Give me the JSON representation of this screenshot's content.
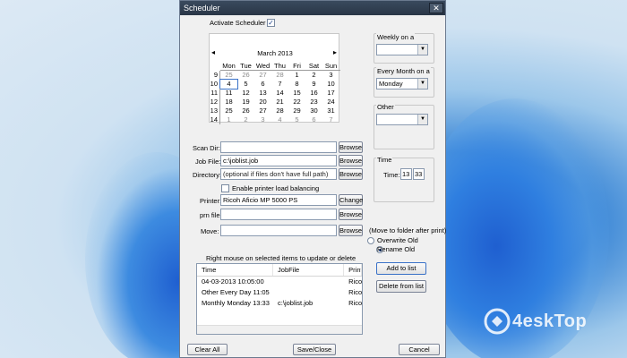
{
  "window": {
    "title": "Scheduler",
    "close_symbol": "✕"
  },
  "activate": {
    "label": "Activate Scheduler",
    "checked": "✓"
  },
  "calendar": {
    "title": "March 2013",
    "prev_symbol": "◂",
    "next_symbol": "▸",
    "dow": [
      "Mon",
      "Tue",
      "Wed",
      "Thu",
      "Fri",
      "Sat",
      "Sun"
    ],
    "weeks": [
      {
        "wk": "9",
        "days": [
          "25",
          "26",
          "27",
          "28",
          "1",
          "2",
          "3"
        ]
      },
      {
        "wk": "10",
        "days": [
          "4",
          "5",
          "6",
          "7",
          "8",
          "9",
          "10"
        ]
      },
      {
        "wk": "11",
        "days": [
          "11",
          "12",
          "13",
          "14",
          "15",
          "16",
          "17"
        ]
      },
      {
        "wk": "12",
        "days": [
          "18",
          "19",
          "20",
          "21",
          "22",
          "23",
          "24"
        ]
      },
      {
        "wk": "13",
        "days": [
          "25",
          "26",
          "27",
          "28",
          "29",
          "30",
          "31"
        ]
      },
      {
        "wk": "14",
        "days": [
          "1",
          "2",
          "3",
          "4",
          "5",
          "6",
          "7"
        ]
      }
    ],
    "selected_day": "4"
  },
  "fields": {
    "scan_dir": {
      "label": "Scan Dir:",
      "value": ""
    },
    "job_file": {
      "label": "Job File:",
      "value": "c:\\joblist.job"
    },
    "directory": {
      "label": "Directory:",
      "value": "(optional if files don't have full path)"
    },
    "load_balancing": {
      "label": "Enable printer load balancing"
    },
    "printer": {
      "label": "Printer:",
      "value": "Ricoh Aficio MP 5000 PS"
    },
    "prn_file": {
      "label": "prn file:",
      "value": ""
    },
    "move": {
      "label": "Move:",
      "value": ""
    }
  },
  "buttons": {
    "browse": "Browse",
    "change": "Change",
    "add_to_list": "Add to list",
    "delete_from_list": "Delete from list",
    "clear_all": "Clear All",
    "save_close": "Save/Close",
    "cancel": "Cancel"
  },
  "right_panel": {
    "weekly_label": "Weekly on a",
    "weekly_value": "",
    "monthly_label": "Every Month on a",
    "monthly_value": "Monday",
    "other_label": "Other",
    "other_value": "",
    "time_group": "Time",
    "time_label": "Time:",
    "time_hour": "13",
    "time_min": "33",
    "move_folder_label": "(Move to folder after print)",
    "overwrite_label": "Overwrite Old",
    "rename_label": "Rename Old"
  },
  "list": {
    "hint": "Right mouse on selected items to update or delete",
    "headers": [
      "Time",
      "JobFile",
      "Printe"
    ],
    "rows": [
      [
        "04-03-2013 10:05:00",
        "",
        "Ricoh"
      ],
      [
        "Other Every Day 11:05",
        "",
        "Ricoh"
      ],
      [
        "Monthly Monday 13:33",
        "c:\\joblist.job",
        "Ricoh"
      ]
    ]
  },
  "watermark": {
    "text": "4eskTop"
  }
}
